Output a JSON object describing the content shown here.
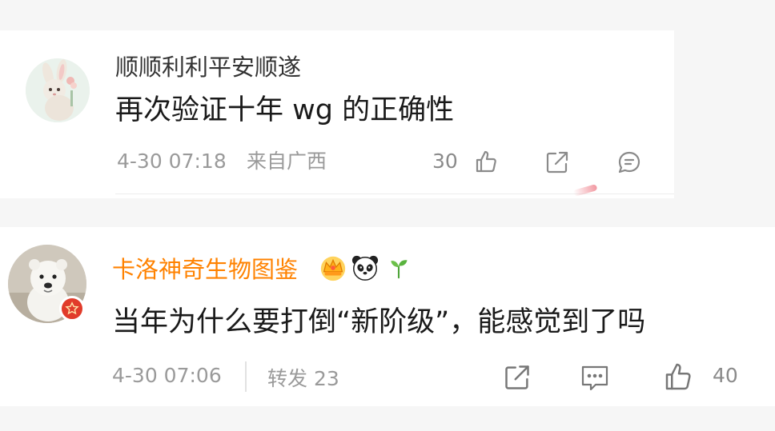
{
  "comments": [
    {
      "username": "顺顺利利平安顺遂",
      "text": "再次验证十年 wg 的正确性",
      "time": "4-30 07:18",
      "location": "来自广西",
      "likes": "30",
      "avatar": "bunny-avatar"
    },
    {
      "username": "卡洛神奇生物图鉴",
      "username_color": "#ff8200",
      "medals": [
        "crown-medal-icon",
        "panda-medal-icon",
        "sprout-medal-icon"
      ],
      "text": "当年为什么要打倒“新阶级”，能感觉到了吗",
      "time": "4-30 07:06",
      "repost": "转发 23",
      "likes": "40",
      "avatar": "polar-bear-avatar"
    }
  ],
  "colors": {
    "accent_orange": "#ff8200",
    "vip_badge": "#e13b2a",
    "meta_gray": "#9a9a9a",
    "background": "#f6f6f6"
  }
}
